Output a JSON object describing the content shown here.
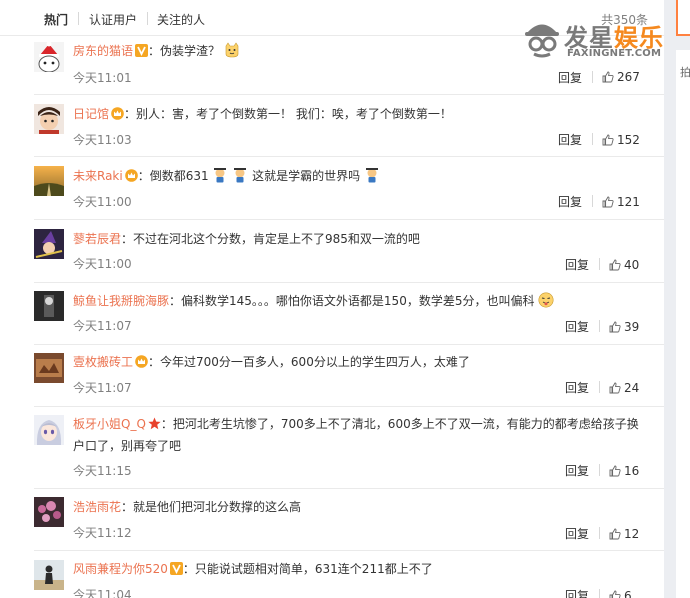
{
  "tabs": [
    {
      "label": "热门",
      "active": true
    },
    {
      "label": "认证用户",
      "active": false
    },
    {
      "label": "关注的人",
      "active": false
    }
  ],
  "total": "共350条",
  "watermark": {
    "part1": "发星",
    "part2": "娱乐",
    "sub": "FAXINGNET.COM"
  },
  "side_fragment": "拍",
  "reply_label": "回复",
  "comments": [
    {
      "user": "房东的猫语",
      "badge": "v-yellow",
      "text": "：伪装学渣？",
      "emoji_after": "cat-face",
      "time": "今天11:01",
      "likes": "267"
    },
    {
      "user": "日记馆",
      "badge": "crown-gold",
      "text": "：别人：害，考了个倒数第一！ 我们：唉，考了个倒数第一！",
      "time": "今天11:03",
      "likes": "152"
    },
    {
      "user": "未来Raki",
      "badge": "crown-gold",
      "text": "：倒数都631",
      "text2": " 这就是学霸的世界吗",
      "time": "今天11:00",
      "likes": "121"
    },
    {
      "user": "蓼若辰君",
      "text": "：不过在河北这个分数，肯定是上不了985和双一流的吧",
      "time": "今天11:00",
      "likes": "40"
    },
    {
      "user": "鲸鱼让我掰腕海豚",
      "text": "：偏科数学145。。。哪怕你语文外语都是150，数学差5分，也叫偏科",
      "emoji_after": "tongue-face",
      "time": "今天11:07",
      "likes": "39"
    },
    {
      "user": "壹枚搬砖工",
      "badge": "crown-gold",
      "text": "：今年过700分一百多人，600分以上的学生四万人，太难了",
      "time": "今天11:07",
      "likes": "24"
    },
    {
      "user": "板牙小姐Q_Q",
      "badge": "star-red",
      "text": "：把河北考生坑惨了，700多上不了清北，600多上不了双一流，有能力的都考虑给孩子换",
      "text_line2": "户口了，别再夸了吧",
      "time": "今天11:15",
      "likes": "16"
    },
    {
      "user": "浩浩雨花",
      "text": "：就是他们把河北分数撑的这么高",
      "time": "今天11:12",
      "likes": "12"
    },
    {
      "user": "风雨兼程为你520",
      "badge": "v-yellow",
      "text": "：只能说试题相对简单，631连个211都上不了",
      "time": "今天11:04",
      "likes": "6"
    }
  ]
}
